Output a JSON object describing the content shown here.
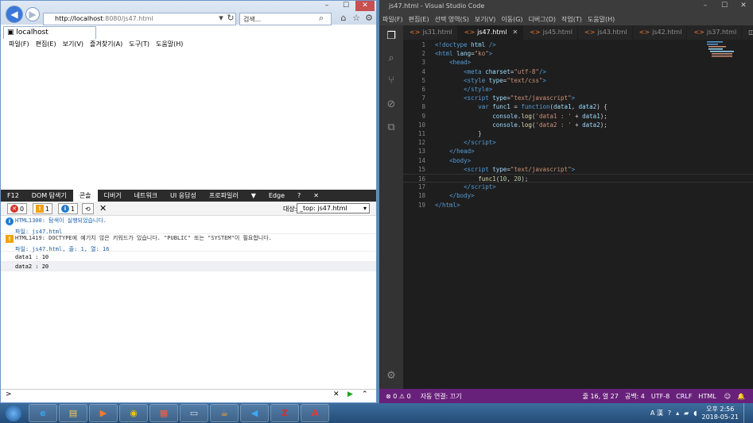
{
  "ie": {
    "address_host": "http://localhost",
    "address_path": ":8080/js47.html",
    "search_placeholder": "검색...",
    "tab_title": "localhost",
    "menu": [
      "파일(F)",
      "편집(E)",
      "보기(V)",
      "즐겨찾기(A)",
      "도구(T)",
      "도움말(H)"
    ]
  },
  "devtools": {
    "tabs": [
      "F12",
      "DOM 탐색기",
      "콘솔",
      "디버거",
      "네트워크",
      "UI 응답성",
      "프로파일러",
      "▼",
      "Edge",
      "?",
      "✕"
    ],
    "active_tab": "콘솔",
    "error_count": "0",
    "warning_count": "1",
    "info_count": "1",
    "target_label": "대상:",
    "target_value": "_top: js47.html",
    "messages": [
      {
        "text": "HTML1300: 탐색이 실행되었습니다.",
        "sub": "파일: js47.html"
      },
      {
        "text": "HTML1419: DOCTYPE에 예기치 않은 키워드가 있습니다. \"PUBLIC\" 또는 \"SYSTEM\"이 필요합니다.",
        "sub": "파일: js47.html, 줄: 1, 열: 16"
      },
      {
        "text": "data1 : 10"
      },
      {
        "text": "data2 : 20"
      }
    ],
    "prompt": ">"
  },
  "vscode": {
    "title": "js47.html - Visual Studio Code",
    "menu": [
      "파일(F)",
      "편집(E)",
      "선택 영역(S)",
      "보기(V)",
      "이동(G)",
      "디버그(D)",
      "작업(T)",
      "도움말(H)"
    ],
    "tabs": [
      {
        "label": "js31.html",
        "active": false
      },
      {
        "label": "js47.html",
        "active": true
      },
      {
        "label": "js45.html",
        "active": false
      },
      {
        "label": "js43.html",
        "active": false
      },
      {
        "label": "js42.html",
        "active": false
      },
      {
        "label": "js37.html",
        "active": false
      }
    ],
    "status": {
      "problems": "⊗ 0 ⚠ 0",
      "live": "자동 연결: 끄기",
      "cursor": "줄 16, 열 27",
      "spaces": "공백: 4",
      "encoding": "UTF-8",
      "eol": "CRLF",
      "language": "HTML"
    }
  },
  "taskbar": {
    "ime": "A 漢",
    "time": "오후 2:56",
    "date": "2018-05-21"
  },
  "colors": {
    "vscode_status": "#68217a",
    "ie_accent": "#3b78d8"
  }
}
